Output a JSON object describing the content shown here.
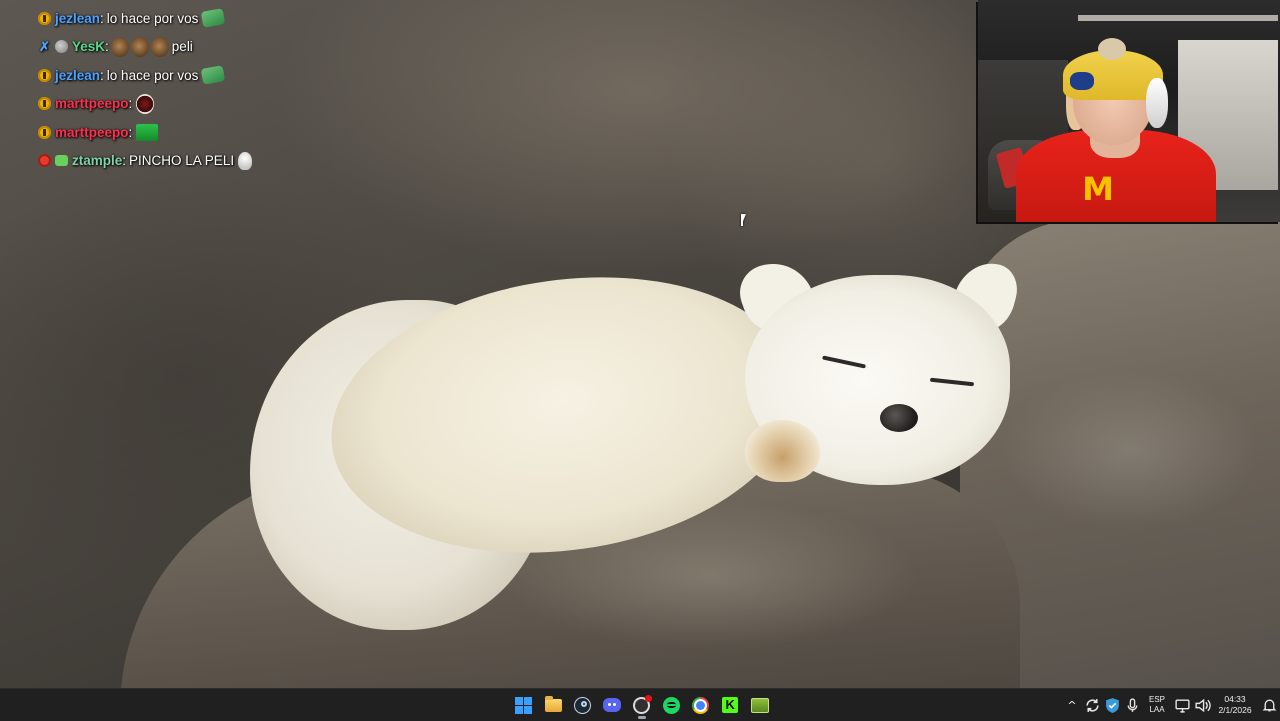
{
  "chat": {
    "messages": [
      {
        "user": "jezlean",
        "separator": ":",
        "text": "lo hace por vos",
        "badges": [
          "gold"
        ],
        "emotes": [
          "money"
        ],
        "user_color": "blue"
      },
      {
        "user": "YesK",
        "separator": ":",
        "text": "peli",
        "badges": [
          "sword",
          "gray"
        ],
        "emotes": [
          "ape",
          "ape",
          "ape"
        ],
        "user_color": "green"
      },
      {
        "user": "jezlean",
        "separator": ":",
        "text": "lo hace por vos",
        "badges": [
          "gold"
        ],
        "emotes": [
          "money"
        ],
        "user_color": "blue"
      },
      {
        "user": "marttpeepo",
        "separator": ":",
        "text": "",
        "badges": [
          "gold"
        ],
        "emotes": [
          "bean"
        ],
        "user_color": "red"
      },
      {
        "user": "marttpeepo",
        "separator": ":",
        "text": "",
        "badges": [
          "gold"
        ],
        "emotes": [
          "box"
        ],
        "user_color": "red"
      },
      {
        "user": "ztample",
        "separator": ":",
        "text": "PINCHO LA PELI",
        "badges": [
          "red",
          "green"
        ],
        "emotes": [
          "hat"
        ],
        "user_color": "gradient"
      }
    ]
  },
  "webcam": {
    "shirt_logo": "M"
  },
  "taskbar": {
    "apps": [
      {
        "name": "start",
        "icon": "windows-start-icon",
        "active": false
      },
      {
        "name": "file-explorer",
        "icon": "folder-icon",
        "active": false
      },
      {
        "name": "steam",
        "icon": "steam-icon",
        "active": false
      },
      {
        "name": "discord",
        "icon": "discord-icon",
        "active": false
      },
      {
        "name": "obs",
        "icon": "obs-icon",
        "active": true
      },
      {
        "name": "spotify",
        "icon": "spotify-icon",
        "active": false
      },
      {
        "name": "chrome",
        "icon": "chrome-icon",
        "active": false
      },
      {
        "name": "kick",
        "icon": "kick-icon",
        "active": false
      },
      {
        "name": "game",
        "icon": "game-icon",
        "active": false
      }
    ],
    "kick_glyph": "K",
    "tray": {
      "chevron": "^",
      "language_top": "ESP",
      "language_bottom": "LAA",
      "time": "04:33",
      "date": "2/1/2026"
    }
  },
  "colors": {
    "taskbar_bg": "#202020",
    "username_blue": "#4aa3ff",
    "username_red": "#ff2e4e",
    "username_green": "#58d88a",
    "shirt_red": "#e8231b"
  }
}
